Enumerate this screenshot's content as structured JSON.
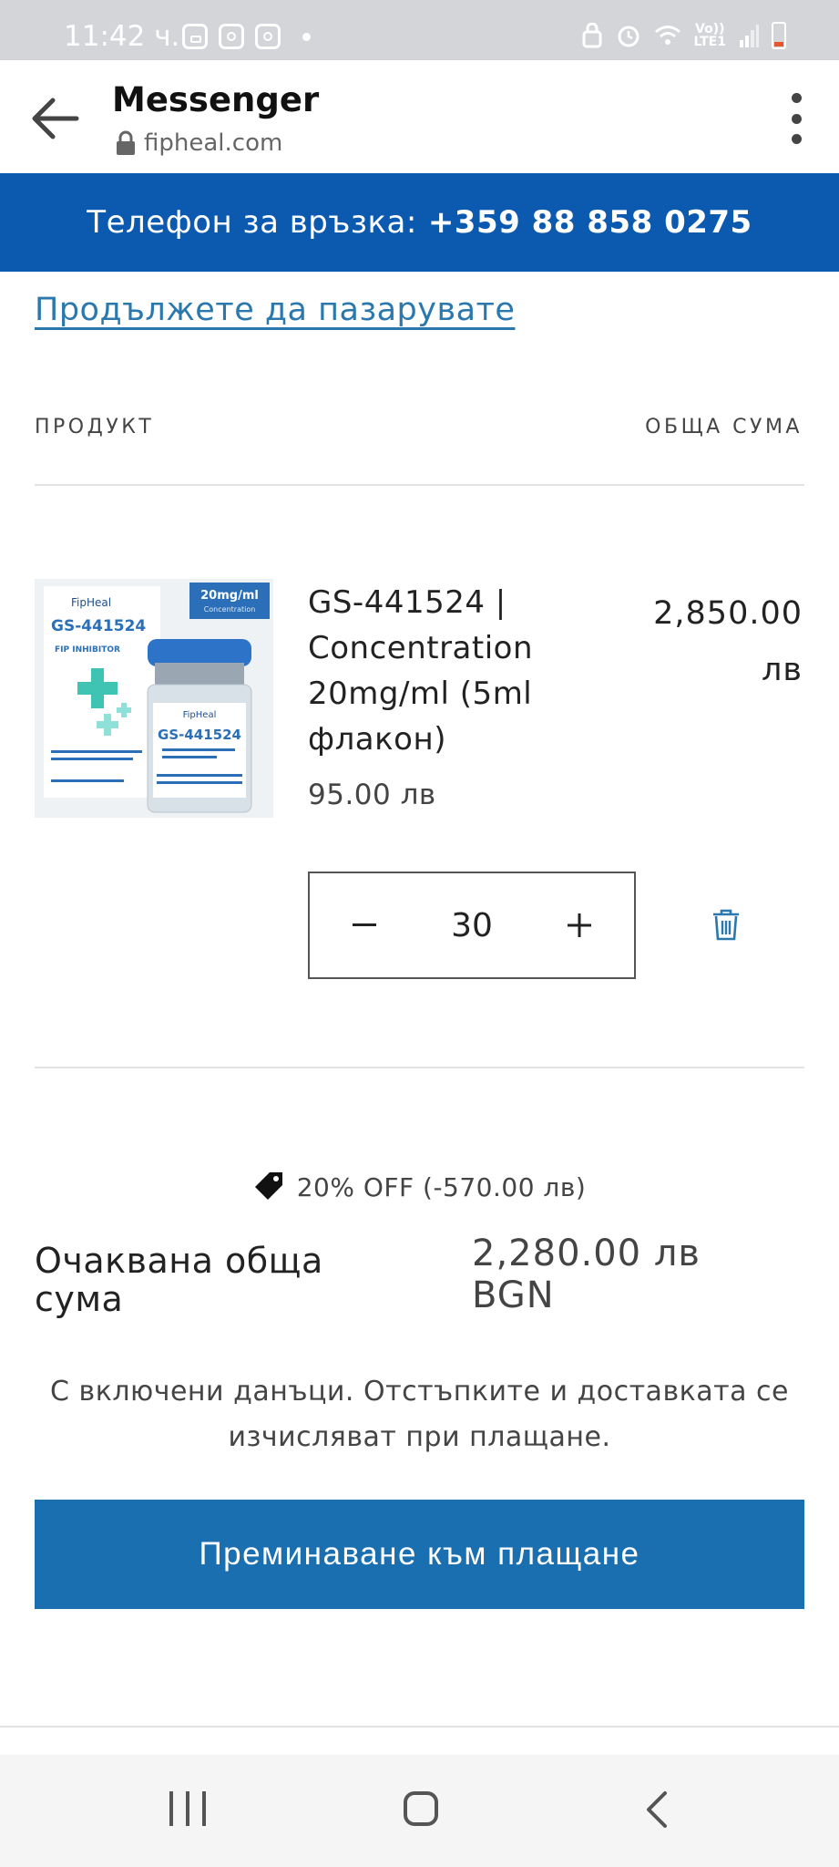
{
  "status_bar": {
    "time": "11:42 ч.",
    "network_top": "Vo))",
    "network_bottom": "LTE1"
  },
  "app_bar": {
    "title": "Messenger",
    "url": "fipheal.com"
  },
  "announcement": {
    "label": "Телефон за връзка:",
    "phone": "+359 88 858 0275"
  },
  "cart": {
    "continue_shopping": "Продължете да пазарувате",
    "col_product": "ПРОДУКТ",
    "col_total": "ОБЩА СУМА",
    "item": {
      "name": "GS-441524 | Concentration 20mg/ml (5ml флакон)",
      "unit_price": "95.00 лв",
      "line_total": "2,850.00 лв",
      "quantity": "30",
      "image_label_brand": "FipHeal",
      "image_label_product": "GS-441524",
      "image_label_sub": "FIP INHIBITOR",
      "image_label_badge": "20mg/ml",
      "image_label_badge_sub": "Concentration"
    },
    "discount": "20% OFF (-570.00 лв)",
    "estimated_total_label": "Очаквана обща сума",
    "estimated_total_value": "2,280.00 лв BGN",
    "tax_note": "С включени данъци. Отстъпките и доставката се изчисляват при плащане.",
    "checkout_button": "Преминаване към плащане"
  },
  "colors": {
    "announcement_bg": "#0b5ab0",
    "button_bg": "#1a6fb0",
    "link": "#2a78ad"
  }
}
